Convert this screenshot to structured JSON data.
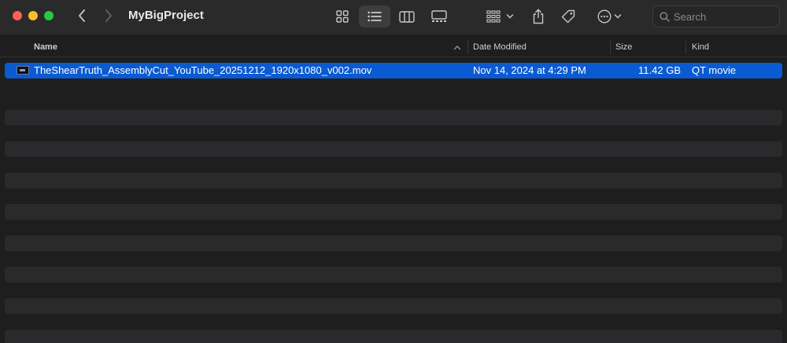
{
  "window": {
    "title": "MyBigProject"
  },
  "toolbar": {
    "back_icon": "chevron-left-icon",
    "forward_icon": "chevron-right-icon",
    "view_icons": [
      "icon-view-icon",
      "list-view-icon",
      "column-view-icon",
      "gallery-view-icon"
    ],
    "group_icon": "group-by-icon",
    "share_icon": "share-icon",
    "tag_icon": "tag-icon",
    "more_icon": "more-actions-icon"
  },
  "search": {
    "placeholder": "Search"
  },
  "columns": {
    "name": "Name",
    "date_modified": "Date Modified",
    "size": "Size",
    "kind": "Kind"
  },
  "files": [
    {
      "name": "TheShearTruth_AssemblyCut_YouTube_20251212_1920x1080_v002.mov",
      "date_modified": "Nov 14, 2024 at 4:29 PM",
      "size": "11.42 GB",
      "kind": "QT movie",
      "selected": true
    }
  ],
  "colors": {
    "accent": "#0a5ad2",
    "close": "#fe5f57",
    "minimize": "#febc2e",
    "maximize": "#28c840"
  }
}
